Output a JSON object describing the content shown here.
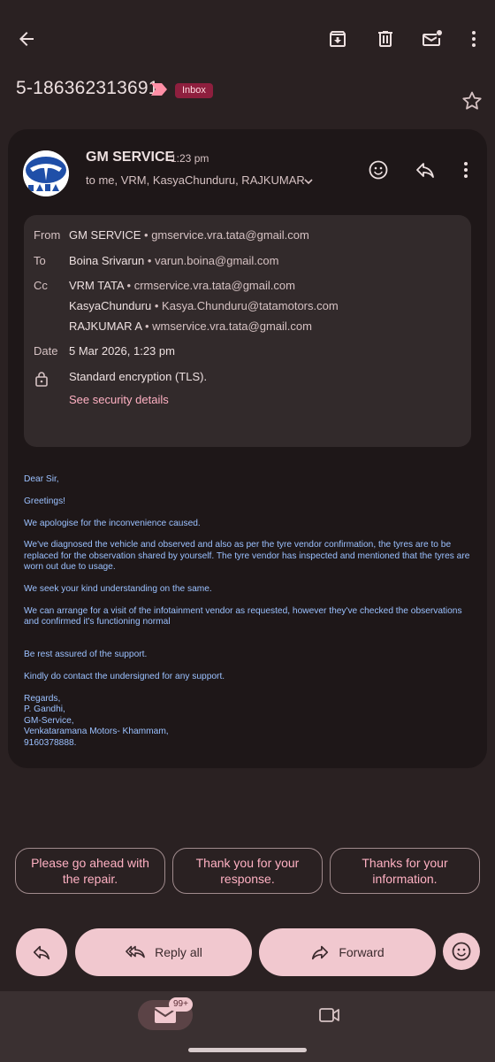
{
  "toolbar": {
    "back_icon": "arrow-back-icon",
    "archive_icon": "archive-icon",
    "delete_icon": "delete-icon",
    "mark_unread_icon": "mark-unread-icon",
    "more_icon": "more-vert-icon"
  },
  "subject": {
    "text": "5-186362313691",
    "label": "Inbox",
    "importance_icon": "importance-marker-icon",
    "star_icon": "star-outline-icon"
  },
  "message": {
    "sender": "GM SERVICE",
    "time": "1:23 pm",
    "recipients_summary": "to me, VRM, KasyaChunduru, RAJKUMAR",
    "details": {
      "from_label": "From",
      "from_name": "GM SERVICE",
      "from_email": "gmservice.vra.tata@gmail.com",
      "to_label": "To",
      "to_name": "Boina Srivarun",
      "to_email": "varun.boina@gmail.com",
      "cc_label": "Cc",
      "cc": [
        {
          "name": "VRM TATA",
          "email": "crmservice.vra.tata@gmail.com"
        },
        {
          "name": "KasyaChunduru",
          "email": "Kasya.Chunduru@tatamotors.com"
        },
        {
          "name": "RAJKUMAR A",
          "email": "wmservice.vra.tata@gmail.com"
        }
      ],
      "date_label": "Date",
      "date_value": "5 Mar 2026, 1:23 pm",
      "encryption": "Standard encryption (TLS).",
      "security_link": "See security details"
    },
    "body": {
      "p1": "Dear Sir,",
      "p2": "Greetings!",
      "p3": "We apologise for the inconvenience caused.",
      "p4": "We've diagnosed the vehicle and observed and also as per the tyre vendor confirmation, the tyres are to be replaced for the observation shared by yourself. The tyre vendor has inspected and mentioned that the tyres are worn out due to usage.",
      "p5": "We seek your kind understanding on the same.",
      "p6": "We can arrange for a visit of the infotainment vendor as requested, however they've checked the observations and confirmed it's functioning normal",
      "p7": "Be rest assured of the support.",
      "p8": "Kindly do contact the undersigned for any support.",
      "sig1": "Regards,",
      "sig2": "P. Gandhi,",
      "sig3": "GM-Service,",
      "sig4": "Venkataramana Motors- Khammam,",
      "sig5": "9160378888."
    }
  },
  "smart_replies": [
    "Please go ahead with the repair.",
    "Thank you for your response.",
    "Thanks for your information."
  ],
  "actions": {
    "reply_all": "Reply all",
    "forward": "Forward"
  },
  "bottom_nav": {
    "mail_badge": "99+"
  },
  "colors": {
    "background": "#2a2122",
    "card": "#1e1718",
    "accent_pink": "#f1c8cf",
    "link": "#ffb1c3",
    "body_text": "#9bc1ff",
    "label_chip": "#8e1f3e"
  }
}
